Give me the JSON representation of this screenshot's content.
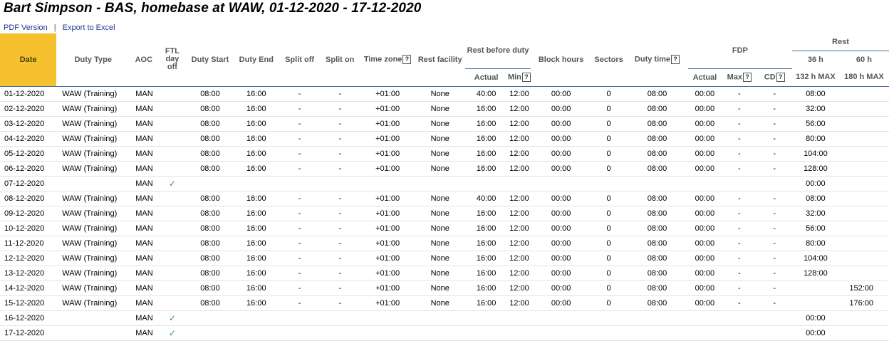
{
  "title": "Bart Simpson - BAS, homebase at WAW, 01-12-2020 - 17-12-2020",
  "links": {
    "pdf": "PDF Version",
    "separator": "|",
    "excel": "Export to Excel"
  },
  "headers": {
    "date": "Date",
    "duty_type": "Duty Type",
    "aoc": "AOC",
    "ftl": "FTL day off",
    "duty_start": "Duty Start",
    "duty_end": "Duty End",
    "split_off": "Split off",
    "split_on": "Split on",
    "time_zone": "Time zone",
    "rest_facility": "Rest facility",
    "rest_before_duty": "Rest before duty",
    "rbd_actual": "Actual",
    "rbd_min": "Min",
    "block_hours": "Block hours",
    "sectors": "Sectors",
    "duty_time": "Duty time",
    "fdp": "FDP",
    "fdp_actual": "Actual",
    "fdp_max": "Max",
    "fdp_cd": "CD",
    "rest": "Rest",
    "rest_36": "36 h",
    "rest_60": "60 h",
    "rest_36_sub": "132 h MAX",
    "rest_60_sub": "180 h MAX",
    "help": "?"
  },
  "check_mark": "✓",
  "rows": [
    {
      "date": "01-12-2020",
      "type": "WAW (Training)",
      "aoc": "MAN",
      "ftl": "",
      "start": "08:00",
      "end": "16:00",
      "soff": "-",
      "son": "-",
      "tz": "+01:00",
      "facility": "None",
      "ract": "40:00",
      "rmin": "12:00",
      "block": "00:00",
      "sectors": "0",
      "duty": "08:00",
      "fact": "00:00",
      "fmax": "-",
      "fcd": "-",
      "r36": "08:00",
      "r60": ""
    },
    {
      "date": "02-12-2020",
      "type": "WAW (Training)",
      "aoc": "MAN",
      "ftl": "",
      "start": "08:00",
      "end": "16:00",
      "soff": "-",
      "son": "-",
      "tz": "+01:00",
      "facility": "None",
      "ract": "16:00",
      "rmin": "12:00",
      "block": "00:00",
      "sectors": "0",
      "duty": "08:00",
      "fact": "00:00",
      "fmax": "-",
      "fcd": "-",
      "r36": "32:00",
      "r60": ""
    },
    {
      "date": "03-12-2020",
      "type": "WAW (Training)",
      "aoc": "MAN",
      "ftl": "",
      "start": "08:00",
      "end": "16:00",
      "soff": "-",
      "son": "-",
      "tz": "+01:00",
      "facility": "None",
      "ract": "16:00",
      "rmin": "12:00",
      "block": "00:00",
      "sectors": "0",
      "duty": "08:00",
      "fact": "00:00",
      "fmax": "-",
      "fcd": "-",
      "r36": "56:00",
      "r60": ""
    },
    {
      "date": "04-12-2020",
      "type": "WAW (Training)",
      "aoc": "MAN",
      "ftl": "",
      "start": "08:00",
      "end": "16:00",
      "soff": "-",
      "son": "-",
      "tz": "+01:00",
      "facility": "None",
      "ract": "16:00",
      "rmin": "12:00",
      "block": "00:00",
      "sectors": "0",
      "duty": "08:00",
      "fact": "00:00",
      "fmax": "-",
      "fcd": "-",
      "r36": "80:00",
      "r60": ""
    },
    {
      "date": "05-12-2020",
      "type": "WAW (Training)",
      "aoc": "MAN",
      "ftl": "",
      "start": "08:00",
      "end": "16:00",
      "soff": "-",
      "son": "-",
      "tz": "+01:00",
      "facility": "None",
      "ract": "16:00",
      "rmin": "12:00",
      "block": "00:00",
      "sectors": "0",
      "duty": "08:00",
      "fact": "00:00",
      "fmax": "-",
      "fcd": "-",
      "r36": "104:00",
      "r60": ""
    },
    {
      "date": "06-12-2020",
      "type": "WAW (Training)",
      "aoc": "MAN",
      "ftl": "",
      "start": "08:00",
      "end": "16:00",
      "soff": "-",
      "son": "-",
      "tz": "+01:00",
      "facility": "None",
      "ract": "16:00",
      "rmin": "12:00",
      "block": "00:00",
      "sectors": "0",
      "duty": "08:00",
      "fact": "00:00",
      "fmax": "-",
      "fcd": "-",
      "r36": "128:00",
      "r60": ""
    },
    {
      "date": "07-12-2020",
      "type": "",
      "aoc": "MAN",
      "ftl": "check",
      "start": "",
      "end": "",
      "soff": "",
      "son": "",
      "tz": "",
      "facility": "",
      "ract": "",
      "rmin": "",
      "block": "",
      "sectors": "",
      "duty": "",
      "fact": "",
      "fmax": "",
      "fcd": "",
      "r36": "00:00",
      "r60": ""
    },
    {
      "date": "08-12-2020",
      "type": "WAW (Training)",
      "aoc": "MAN",
      "ftl": "",
      "start": "08:00",
      "end": "16:00",
      "soff": "-",
      "son": "-",
      "tz": "+01:00",
      "facility": "None",
      "ract": "40:00",
      "rmin": "12:00",
      "block": "00:00",
      "sectors": "0",
      "duty": "08:00",
      "fact": "00:00",
      "fmax": "-",
      "fcd": "-",
      "r36": "08:00",
      "r60": ""
    },
    {
      "date": "09-12-2020",
      "type": "WAW (Training)",
      "aoc": "MAN",
      "ftl": "",
      "start": "08:00",
      "end": "16:00",
      "soff": "-",
      "son": "-",
      "tz": "+01:00",
      "facility": "None",
      "ract": "16:00",
      "rmin": "12:00",
      "block": "00:00",
      "sectors": "0",
      "duty": "08:00",
      "fact": "00:00",
      "fmax": "-",
      "fcd": "-",
      "r36": "32:00",
      "r60": ""
    },
    {
      "date": "10-12-2020",
      "type": "WAW (Training)",
      "aoc": "MAN",
      "ftl": "",
      "start": "08:00",
      "end": "16:00",
      "soff": "-",
      "son": "-",
      "tz": "+01:00",
      "facility": "None",
      "ract": "16:00",
      "rmin": "12:00",
      "block": "00:00",
      "sectors": "0",
      "duty": "08:00",
      "fact": "00:00",
      "fmax": "-",
      "fcd": "-",
      "r36": "56:00",
      "r60": ""
    },
    {
      "date": "11-12-2020",
      "type": "WAW (Training)",
      "aoc": "MAN",
      "ftl": "",
      "start": "08:00",
      "end": "16:00",
      "soff": "-",
      "son": "-",
      "tz": "+01:00",
      "facility": "None",
      "ract": "16:00",
      "rmin": "12:00",
      "block": "00:00",
      "sectors": "0",
      "duty": "08:00",
      "fact": "00:00",
      "fmax": "-",
      "fcd": "-",
      "r36": "80:00",
      "r60": ""
    },
    {
      "date": "12-12-2020",
      "type": "WAW (Training)",
      "aoc": "MAN",
      "ftl": "",
      "start": "08:00",
      "end": "16:00",
      "soff": "-",
      "son": "-",
      "tz": "+01:00",
      "facility": "None",
      "ract": "16:00",
      "rmin": "12:00",
      "block": "00:00",
      "sectors": "0",
      "duty": "08:00",
      "fact": "00:00",
      "fmax": "-",
      "fcd": "-",
      "r36": "104:00",
      "r60": ""
    },
    {
      "date": "13-12-2020",
      "type": "WAW (Training)",
      "aoc": "MAN",
      "ftl": "",
      "start": "08:00",
      "end": "16:00",
      "soff": "-",
      "son": "-",
      "tz": "+01:00",
      "facility": "None",
      "ract": "16:00",
      "rmin": "12:00",
      "block": "00:00",
      "sectors": "0",
      "duty": "08:00",
      "fact": "00:00",
      "fmax": "-",
      "fcd": "-",
      "r36": "128:00",
      "r60": ""
    },
    {
      "date": "14-12-2020",
      "type": "WAW (Training)",
      "aoc": "MAN",
      "ftl": "",
      "start": "08:00",
      "end": "16:00",
      "soff": "-",
      "son": "-",
      "tz": "+01:00",
      "facility": "None",
      "ract": "16:00",
      "rmin": "12:00",
      "block": "00:00",
      "sectors": "0",
      "duty": "08:00",
      "fact": "00:00",
      "fmax": "-",
      "fcd": "-",
      "r36": "",
      "r60": "152:00"
    },
    {
      "date": "15-12-2020",
      "type": "WAW (Training)",
      "aoc": "MAN",
      "ftl": "",
      "start": "08:00",
      "end": "16:00",
      "soff": "-",
      "son": "-",
      "tz": "+01:00",
      "facility": "None",
      "ract": "16:00",
      "rmin": "12:00",
      "block": "00:00",
      "sectors": "0",
      "duty": "08:00",
      "fact": "00:00",
      "fmax": "-",
      "fcd": "-",
      "r36": "",
      "r60": "176:00"
    },
    {
      "date": "16-12-2020",
      "type": "",
      "aoc": "MAN",
      "ftl": "check",
      "start": "",
      "end": "",
      "soff": "",
      "son": "",
      "tz": "",
      "facility": "",
      "ract": "",
      "rmin": "",
      "block": "",
      "sectors": "",
      "duty": "",
      "fact": "",
      "fmax": "",
      "fcd": "",
      "r36": "00:00",
      "r60": ""
    },
    {
      "date": "17-12-2020",
      "type": "",
      "aoc": "MAN",
      "ftl": "check",
      "start": "",
      "end": "",
      "soff": "",
      "son": "",
      "tz": "",
      "facility": "",
      "ract": "",
      "rmin": "",
      "block": "",
      "sectors": "",
      "duty": "",
      "fact": "",
      "fmax": "",
      "fcd": "",
      "r36": "00:00",
      "r60": ""
    }
  ]
}
